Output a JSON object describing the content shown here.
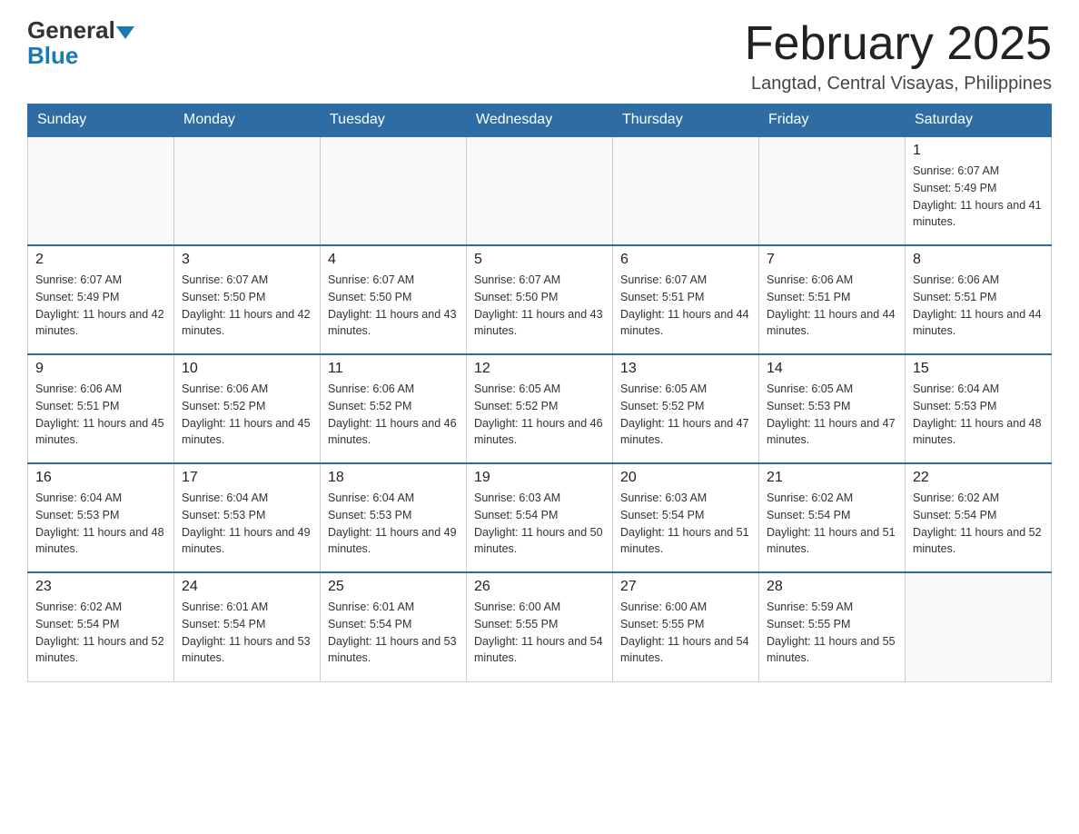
{
  "logo": {
    "general": "General",
    "blue": "Blue"
  },
  "header": {
    "month_title": "February 2025",
    "location": "Langtad, Central Visayas, Philippines"
  },
  "weekdays": [
    "Sunday",
    "Monday",
    "Tuesday",
    "Wednesday",
    "Thursday",
    "Friday",
    "Saturday"
  ],
  "weeks": [
    [
      {
        "day": "",
        "sunrise": "",
        "sunset": "",
        "daylight": ""
      },
      {
        "day": "",
        "sunrise": "",
        "sunset": "",
        "daylight": ""
      },
      {
        "day": "",
        "sunrise": "",
        "sunset": "",
        "daylight": ""
      },
      {
        "day": "",
        "sunrise": "",
        "sunset": "",
        "daylight": ""
      },
      {
        "day": "",
        "sunrise": "",
        "sunset": "",
        "daylight": ""
      },
      {
        "day": "",
        "sunrise": "",
        "sunset": "",
        "daylight": ""
      },
      {
        "day": "1",
        "sunrise": "Sunrise: 6:07 AM",
        "sunset": "Sunset: 5:49 PM",
        "daylight": "Daylight: 11 hours and 41 minutes."
      }
    ],
    [
      {
        "day": "2",
        "sunrise": "Sunrise: 6:07 AM",
        "sunset": "Sunset: 5:49 PM",
        "daylight": "Daylight: 11 hours and 42 minutes."
      },
      {
        "day": "3",
        "sunrise": "Sunrise: 6:07 AM",
        "sunset": "Sunset: 5:50 PM",
        "daylight": "Daylight: 11 hours and 42 minutes."
      },
      {
        "day": "4",
        "sunrise": "Sunrise: 6:07 AM",
        "sunset": "Sunset: 5:50 PM",
        "daylight": "Daylight: 11 hours and 43 minutes."
      },
      {
        "day": "5",
        "sunrise": "Sunrise: 6:07 AM",
        "sunset": "Sunset: 5:50 PM",
        "daylight": "Daylight: 11 hours and 43 minutes."
      },
      {
        "day": "6",
        "sunrise": "Sunrise: 6:07 AM",
        "sunset": "Sunset: 5:51 PM",
        "daylight": "Daylight: 11 hours and 44 minutes."
      },
      {
        "day": "7",
        "sunrise": "Sunrise: 6:06 AM",
        "sunset": "Sunset: 5:51 PM",
        "daylight": "Daylight: 11 hours and 44 minutes."
      },
      {
        "day": "8",
        "sunrise": "Sunrise: 6:06 AM",
        "sunset": "Sunset: 5:51 PM",
        "daylight": "Daylight: 11 hours and 44 minutes."
      }
    ],
    [
      {
        "day": "9",
        "sunrise": "Sunrise: 6:06 AM",
        "sunset": "Sunset: 5:51 PM",
        "daylight": "Daylight: 11 hours and 45 minutes."
      },
      {
        "day": "10",
        "sunrise": "Sunrise: 6:06 AM",
        "sunset": "Sunset: 5:52 PM",
        "daylight": "Daylight: 11 hours and 45 minutes."
      },
      {
        "day": "11",
        "sunrise": "Sunrise: 6:06 AM",
        "sunset": "Sunset: 5:52 PM",
        "daylight": "Daylight: 11 hours and 46 minutes."
      },
      {
        "day": "12",
        "sunrise": "Sunrise: 6:05 AM",
        "sunset": "Sunset: 5:52 PM",
        "daylight": "Daylight: 11 hours and 46 minutes."
      },
      {
        "day": "13",
        "sunrise": "Sunrise: 6:05 AM",
        "sunset": "Sunset: 5:52 PM",
        "daylight": "Daylight: 11 hours and 47 minutes."
      },
      {
        "day": "14",
        "sunrise": "Sunrise: 6:05 AM",
        "sunset": "Sunset: 5:53 PM",
        "daylight": "Daylight: 11 hours and 47 minutes."
      },
      {
        "day": "15",
        "sunrise": "Sunrise: 6:04 AM",
        "sunset": "Sunset: 5:53 PM",
        "daylight": "Daylight: 11 hours and 48 minutes."
      }
    ],
    [
      {
        "day": "16",
        "sunrise": "Sunrise: 6:04 AM",
        "sunset": "Sunset: 5:53 PM",
        "daylight": "Daylight: 11 hours and 48 minutes."
      },
      {
        "day": "17",
        "sunrise": "Sunrise: 6:04 AM",
        "sunset": "Sunset: 5:53 PM",
        "daylight": "Daylight: 11 hours and 49 minutes."
      },
      {
        "day": "18",
        "sunrise": "Sunrise: 6:04 AM",
        "sunset": "Sunset: 5:53 PM",
        "daylight": "Daylight: 11 hours and 49 minutes."
      },
      {
        "day": "19",
        "sunrise": "Sunrise: 6:03 AM",
        "sunset": "Sunset: 5:54 PM",
        "daylight": "Daylight: 11 hours and 50 minutes."
      },
      {
        "day": "20",
        "sunrise": "Sunrise: 6:03 AM",
        "sunset": "Sunset: 5:54 PM",
        "daylight": "Daylight: 11 hours and 51 minutes."
      },
      {
        "day": "21",
        "sunrise": "Sunrise: 6:02 AM",
        "sunset": "Sunset: 5:54 PM",
        "daylight": "Daylight: 11 hours and 51 minutes."
      },
      {
        "day": "22",
        "sunrise": "Sunrise: 6:02 AM",
        "sunset": "Sunset: 5:54 PM",
        "daylight": "Daylight: 11 hours and 52 minutes."
      }
    ],
    [
      {
        "day": "23",
        "sunrise": "Sunrise: 6:02 AM",
        "sunset": "Sunset: 5:54 PM",
        "daylight": "Daylight: 11 hours and 52 minutes."
      },
      {
        "day": "24",
        "sunrise": "Sunrise: 6:01 AM",
        "sunset": "Sunset: 5:54 PM",
        "daylight": "Daylight: 11 hours and 53 minutes."
      },
      {
        "day": "25",
        "sunrise": "Sunrise: 6:01 AM",
        "sunset": "Sunset: 5:54 PM",
        "daylight": "Daylight: 11 hours and 53 minutes."
      },
      {
        "day": "26",
        "sunrise": "Sunrise: 6:00 AM",
        "sunset": "Sunset: 5:55 PM",
        "daylight": "Daylight: 11 hours and 54 minutes."
      },
      {
        "day": "27",
        "sunrise": "Sunrise: 6:00 AM",
        "sunset": "Sunset: 5:55 PM",
        "daylight": "Daylight: 11 hours and 54 minutes."
      },
      {
        "day": "28",
        "sunrise": "Sunrise: 5:59 AM",
        "sunset": "Sunset: 5:55 PM",
        "daylight": "Daylight: 11 hours and 55 minutes."
      },
      {
        "day": "",
        "sunrise": "",
        "sunset": "",
        "daylight": ""
      }
    ]
  ]
}
